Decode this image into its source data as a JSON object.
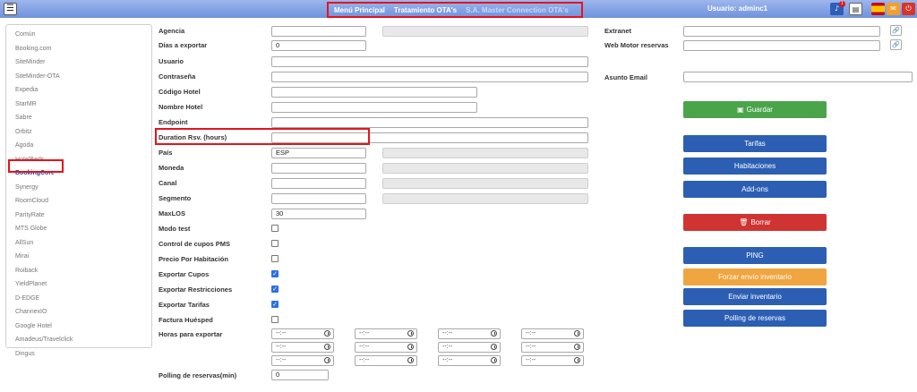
{
  "topbar": {
    "menu_icon": "hamburger-menu-icon",
    "nav": [
      "Menú Principal",
      "Tratamiento OTA's",
      "S.A. Master Connection OTA's"
    ],
    "usuario": "Usuario: adminc1",
    "notification_count": "1",
    "icons": [
      "bell-icon",
      "document-icon",
      "spain-flag-icon",
      "mail-icon",
      "power-icon"
    ]
  },
  "sidebar": {
    "items": [
      "Común",
      "Booking.com",
      "SiteMinder",
      "SiteMinder-OTA",
      "Expedia",
      "StarMR",
      "Sabre",
      "Orbitz",
      "Agoda",
      "HotelBeds",
      "BookingCore",
      "Synergy",
      "RoomCloud",
      "ParityRate",
      "MTS Globe",
      "AllSun",
      "Mirai",
      "Roiback",
      "YieldPlanet",
      "D-EDGE",
      "ChannexIO",
      "Google Hotel",
      "Amadeus/Travelclick",
      "Dingus"
    ],
    "active": "BookingCore"
  },
  "form": {
    "agencia": "Agencia",
    "dias_exportar": "Días a exportar",
    "dias_exportar_value": "0",
    "usuario": "Usuario",
    "contrasena": "Contraseña",
    "codigo_hotel": "Código Hotel",
    "nombre_hotel": "Nombre Hotel",
    "endpoint": "Endpoint",
    "duration": "Duration Rsv. (hours)",
    "pais": "País",
    "pais_value": "ESP",
    "moneda": "Moneda",
    "canal": "Canal",
    "segmento": "Segmento",
    "maxlos": "MaxLOS",
    "maxlos_value": "30",
    "modo_test": "Modo test",
    "control_cupos": "Control de cupos PMS",
    "precio_habitacion": "Precio Por Habitación",
    "exportar_cupos": "Exportar Cupos",
    "exportar_restricciones": "Exportar Restricciones",
    "exportar_tarifas": "Exportar Tarifas",
    "factura_huesped": "Factura Huésped",
    "horas_exportar": "Horas para exportar",
    "time_placeholder": "--:--",
    "polling_min": "Polling de reservas(min)",
    "polling_min_value": "0",
    "extranet": "Extranet",
    "web_motor": "Web Motor reservas",
    "asunto_email": "Asunto Email"
  },
  "checkboxes": {
    "modo_test": false,
    "control_cupos": false,
    "precio_habitacion": false,
    "exportar_cupos": true,
    "exportar_restricciones": true,
    "exportar_tarifas": true,
    "factura_huesped": false
  },
  "buttons": {
    "guardar": "Guardar",
    "tarifas": "Tarifas",
    "habitaciones": "Habitaciones",
    "addons": "Add-ons",
    "borrar": "Borrar",
    "ping": "PING",
    "forzar": "Forzar envío inventario",
    "enviar": "Enviar inventario",
    "polling": "Polling de reservas"
  },
  "colors": {
    "topbar": "#7b9be0",
    "highlight": "#e3141c",
    "primary": "#2c5fb3",
    "success": "#4aa54a",
    "danger": "#cf3432",
    "warning": "#f0a540"
  }
}
